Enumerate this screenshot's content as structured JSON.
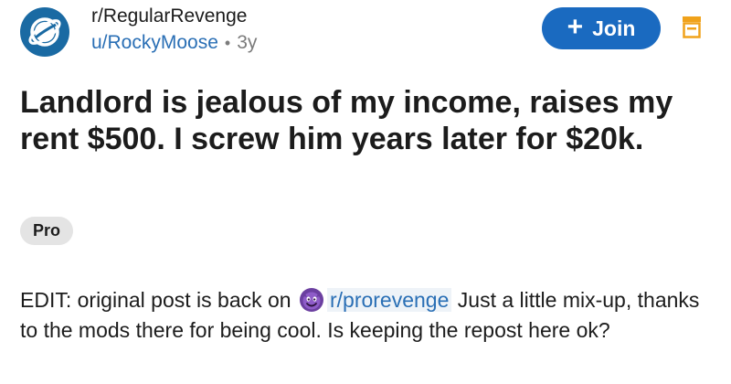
{
  "header": {
    "subreddit": "r/RegularRevenge",
    "username": "u/RockyMoose",
    "separator": "•",
    "age": "3y",
    "join_label": "Join",
    "join_plus": "+",
    "avatar_icon": "planet-icon",
    "save_icon": "save-icon"
  },
  "post": {
    "title": "Landlord is jealous of my income, raises my rent $500. I screw him years later for $20k.",
    "flair": "Pro",
    "body_before_link": "EDIT: original post is back on ",
    "body_link": "r/prorevenge",
    "body_after_link": " Just a little mix-up, thanks to the mods there for being cool. Is keeping the repost here ok?",
    "link_icon": "devil-face-icon"
  },
  "colors": {
    "accent": "#1a6ac0",
    "link": "#2a6fb5",
    "flair_bg": "#e4e4e4",
    "save_icon": "#f0a21b"
  }
}
